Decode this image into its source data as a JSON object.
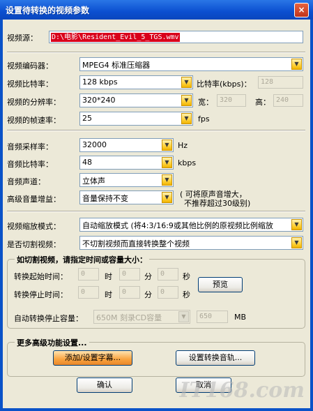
{
  "window": {
    "title": "设置待转换的视频参数",
    "close": "×"
  },
  "source": {
    "label": "视频源：",
    "value": "D:\\电影\\Resident_Evil_5_TGS.wmv"
  },
  "video": {
    "encoder_label": "视频编码器：",
    "encoder_value": "MPEG4 标准压缩器",
    "bitrate_label": "视频比特率：",
    "bitrate_value": "128 kbps",
    "bitrate_kbps_label": "比特率(kbps)：",
    "bitrate_kbps_value": "128",
    "resolution_label": "视频的分辨率：",
    "resolution_value": "320*240",
    "width_label": "宽：",
    "width_value": "320",
    "height_label": "高：",
    "height_value": "240",
    "fps_label": "视频的帧速率：",
    "fps_value": "25",
    "fps_unit": "fps"
  },
  "audio": {
    "samplerate_label": "音频采样率：",
    "samplerate_value": "32000",
    "samplerate_unit": "Hz",
    "bitrate_label": "音频比特率：",
    "bitrate_value": "48",
    "bitrate_unit": "kbps",
    "channel_label": "音频声道：",
    "channel_value": "立体声",
    "gain_label": "高级音量增益：",
    "gain_value": "音量保持不变",
    "gain_note_1": "( 可将原声音增大，",
    "gain_note_2": "不推荐超过30级别)"
  },
  "scale": {
    "label": "视频缩放模式：",
    "value": "自动缩放模式 (将4:3/16:9或其他比例的原视频比例缩放",
    "cut_label": "是否切割视频：",
    "cut_value": "不切割视频而直接转换整个视频"
  },
  "cut_group": {
    "caption": "如切割视频，请指定时间或容量大小：",
    "start_label": "转换起始时间：",
    "stop_label": "转换停止时间：",
    "start_h": "0",
    "start_m": "0",
    "start_s": "0",
    "stop_h": "0",
    "stop_m": "0",
    "stop_s": "0",
    "hour_unit": "时",
    "min_unit": "分",
    "sec_unit": "秒",
    "preview_button": "预览",
    "auto_stop_label": "自动转换停止容量：",
    "auto_stop_value": "650M 刻录CD容量",
    "size_value": "650",
    "size_unit": "MB"
  },
  "advanced_group": {
    "caption": "更多高级功能设置...",
    "subtitle_button": "添加/设置字幕...",
    "audio_track_button": "设置转换音轨..."
  },
  "footer": {
    "ok_button": "确认",
    "cancel_button": "取消",
    "watermark": "IT168.com"
  }
}
